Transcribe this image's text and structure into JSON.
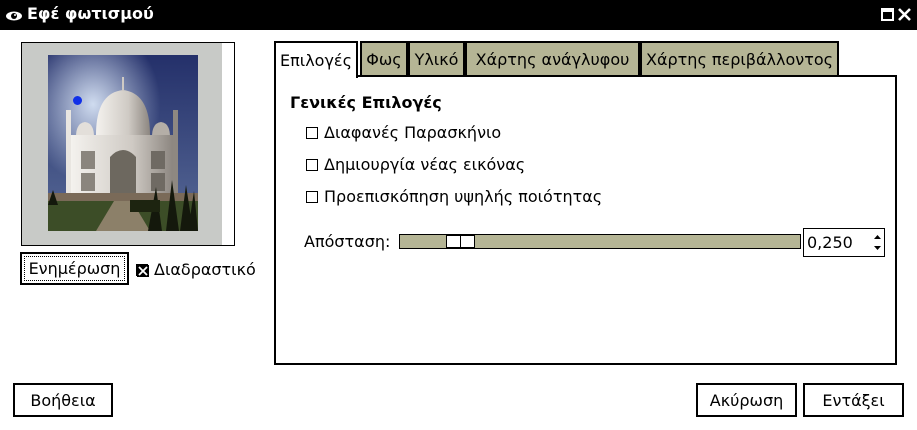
{
  "window": {
    "title": "Εφέ φωτισμού",
    "icons": [
      "app-eye-icon",
      "maximize-icon",
      "close-icon"
    ]
  },
  "preview": {
    "update_label": "Ενημέρωση",
    "interactive_label": "Διαδραστικό",
    "interactive_checked": true
  },
  "tabs": [
    {
      "label": "Επιλογές",
      "active": true
    },
    {
      "label": "Φως",
      "active": false
    },
    {
      "label": "Υλικό",
      "active": false
    },
    {
      "label": "Χάρτης ανάγλυφου",
      "active": false
    },
    {
      "label": "Χάρτης περιβάλλοντος",
      "active": false
    }
  ],
  "options": {
    "section_title": "Γενικές Επιλογές",
    "checkboxes": [
      {
        "label": "Διαφανές Παρασκήνιο",
        "checked": false
      },
      {
        "label": "Δημιουργία νέας εικόνας",
        "checked": false
      },
      {
        "label": "Προεπισκόπηση υψηλής ποιότητας",
        "checked": false
      }
    ],
    "distance_label": "Απόσταση:",
    "distance_value": "0,250",
    "distance_fraction": 0.125
  },
  "buttons": {
    "help": "Βοήθεια",
    "cancel": "Ακύρωση",
    "ok": "Εντάξει"
  },
  "colors": {
    "titlebar": "#000000",
    "tab_inactive": "#b5b595",
    "preview_background": "#c8cac7",
    "light_marker": "#1030e8"
  }
}
